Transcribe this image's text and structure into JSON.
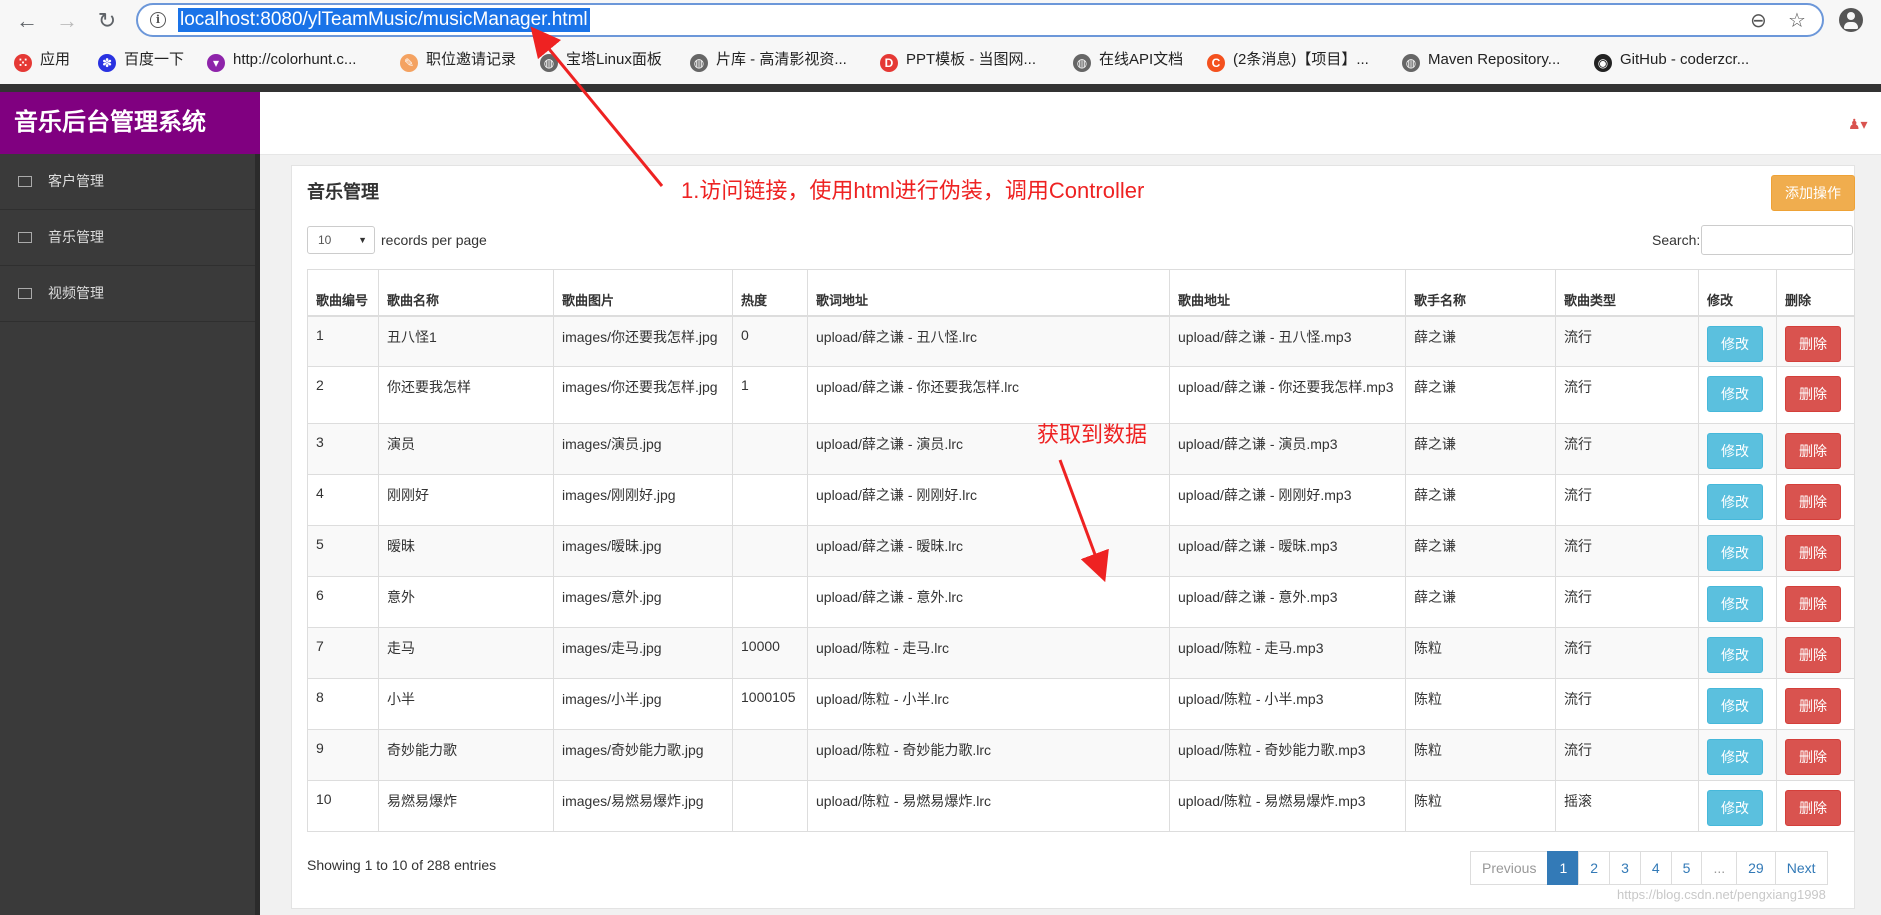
{
  "browser": {
    "url": "localhost:8080/ylTeamMusic/musicManager.html",
    "bookmarks": [
      {
        "label": "应用",
        "icon": "apps-grid-icon"
      },
      {
        "label": "百度一下",
        "icon": "baidu-paw-icon"
      },
      {
        "label": "http://colorhunt.c...",
        "icon": "colorhunt-icon"
      },
      {
        "label": "职位邀请记录",
        "icon": "job-icon"
      },
      {
        "label": "宝塔Linux面板",
        "icon": "globe-icon"
      },
      {
        "label": "片库 - 高清影视资...",
        "icon": "globe-icon"
      },
      {
        "label": "PPT模板 - 当图网...",
        "icon": "ppt-icon"
      },
      {
        "label": "在线API文档",
        "icon": "globe-icon"
      },
      {
        "label": "(2条消息)【项目】...",
        "icon": "csdn-icon"
      },
      {
        "label": "Maven Repository...",
        "icon": "globe-icon"
      },
      {
        "label": "GitHub - coderzcr...",
        "icon": "github-icon"
      }
    ]
  },
  "app": {
    "brand": "音乐后台管理系统",
    "sidebar": [
      {
        "label": "客户管理",
        "icon": "monitor-icon"
      },
      {
        "label": "音乐管理",
        "icon": "grid-icon"
      },
      {
        "label": "视频管理",
        "icon": "card-icon"
      }
    ],
    "panel_title": "音乐管理",
    "add_button": "添加操作",
    "length_value": "10",
    "length_label": "records per page",
    "search_label": "Search:",
    "table": {
      "headers": [
        "歌曲编号",
        "歌曲名称",
        "歌曲图片",
        "热度",
        "歌词地址",
        "歌曲地址",
        "歌手名称",
        "歌曲类型",
        "修改",
        "删除"
      ],
      "edit_label": "修改",
      "delete_label": "删除",
      "rows": [
        [
          "1",
          "丑八怪1",
          "images/你还要我怎样.jpg",
          "0",
          "upload/薛之谦 - 丑八怪.lrc",
          "upload/薛之谦 - 丑八怪.mp3",
          "薛之谦",
          "流行"
        ],
        [
          "2",
          "你还要我怎样",
          "images/你还要我怎样.jpg",
          "1",
          "upload/薛之谦 - 你还要我怎样.lrc",
          "upload/薛之谦 - 你还要我怎样.mp3",
          "薛之谦",
          "流行"
        ],
        [
          "3",
          "演员",
          "images/演员.jpg",
          "",
          "upload/薛之谦 - 演员.lrc",
          "upload/薛之谦 - 演员.mp3",
          "薛之谦",
          "流行"
        ],
        [
          "4",
          "刚刚好",
          "images/刚刚好.jpg",
          "",
          "upload/薛之谦 - 刚刚好.lrc",
          "upload/薛之谦 - 刚刚好.mp3",
          "薛之谦",
          "流行"
        ],
        [
          "5",
          "暧昧",
          "images/暧昧.jpg",
          "",
          "upload/薛之谦 - 暧昧.lrc",
          "upload/薛之谦 - 暧昧.mp3",
          "薛之谦",
          "流行"
        ],
        [
          "6",
          "意外",
          "images/意外.jpg",
          "",
          "upload/薛之谦 - 意外.lrc",
          "upload/薛之谦 - 意外.mp3",
          "薛之谦",
          "流行"
        ],
        [
          "7",
          "走马",
          "images/走马.jpg",
          "10000",
          "upload/陈粒 - 走马.lrc",
          "upload/陈粒 - 走马.mp3",
          "陈粒",
          "流行"
        ],
        [
          "8",
          "小半",
          "images/小半.jpg",
          "1000105",
          "upload/陈粒 - 小半.lrc",
          "upload/陈粒 - 小半.mp3",
          "陈粒",
          "流行"
        ],
        [
          "9",
          "奇妙能力歌",
          "images/奇妙能力歌.jpg",
          "",
          "upload/陈粒 - 奇妙能力歌.lrc",
          "upload/陈粒 - 奇妙能力歌.mp3",
          "陈粒",
          "流行"
        ],
        [
          "10",
          "易燃易爆炸",
          "images/易燃易爆炸.jpg",
          "",
          "upload/陈粒 - 易燃易爆炸.lrc",
          "upload/陈粒 - 易燃易爆炸.mp3",
          "陈粒",
          "摇滚"
        ]
      ]
    },
    "info": "Showing 1 to 10 of 288 entries",
    "pagination": [
      "Previous",
      "1",
      "2",
      "3",
      "4",
      "5",
      "...",
      "29",
      "Next"
    ],
    "active_page": "1",
    "watermark": "https://blog.csdn.net/pengxiang1998"
  },
  "annotations": {
    "note1": "1.访问链接，使用html进行伪装，调用Controller",
    "note2": "获取到数据",
    "color": "#ee2222"
  },
  "colors": {
    "brand_bg": "#800080",
    "sidebar_bg": "#3a3a3a",
    "add_button": "#f0ad4e",
    "edit_button": "#5bc0de",
    "delete_button": "#d9534f",
    "page_active": "#337ab7"
  }
}
